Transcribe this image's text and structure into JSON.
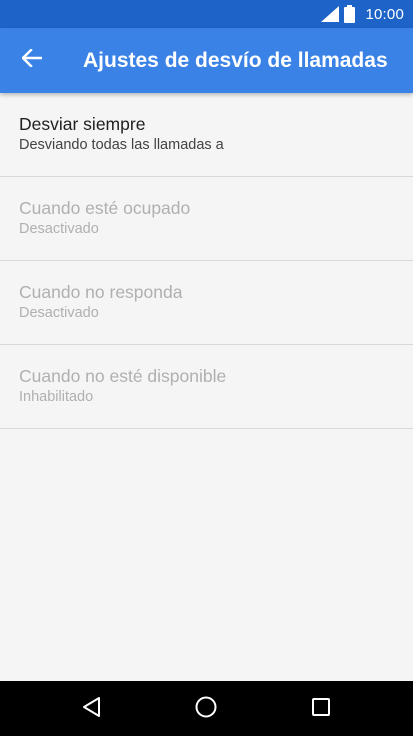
{
  "status_bar": {
    "time": "10:00",
    "icons": [
      "signal-icon",
      "battery-icon"
    ]
  },
  "app_bar": {
    "back_icon": "back-arrow-icon",
    "title": "Ajustes de desvío de llamadas"
  },
  "settings": [
    {
      "title": "Desviar siempre",
      "summary": "Desviando todas las llamadas a",
      "enabled": true
    },
    {
      "title": "Cuando esté ocupado",
      "summary": "Desactivado",
      "enabled": false
    },
    {
      "title": "Cuando no responda",
      "summary": "Desactivado",
      "enabled": false
    },
    {
      "title": "Cuando no esté disponible",
      "summary": "Inhabilitado",
      "enabled": false
    }
  ],
  "nav_bar": {
    "icons": [
      "back-triangle-icon",
      "home-circle-icon",
      "recents-square-icon"
    ]
  },
  "colors": {
    "status_bar": "#1e64c8",
    "app_bar": "#3b82e6",
    "background": "#f5f5f5",
    "enabled_text": "#212121",
    "disabled_text": "#b0b0b0"
  }
}
